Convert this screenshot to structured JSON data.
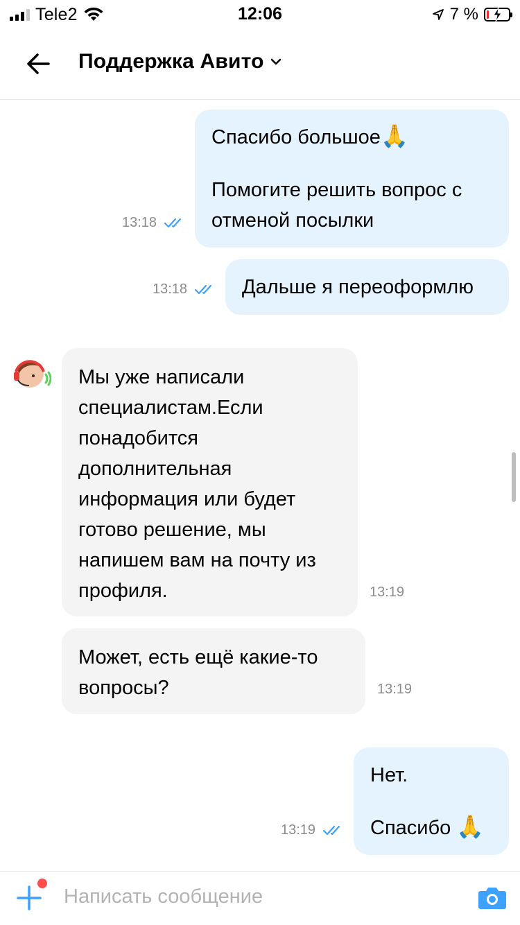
{
  "status_bar": {
    "carrier": "Tele2",
    "time": "12:06",
    "battery_percent": "7 %"
  },
  "header": {
    "title": "Поддержка Авито"
  },
  "messages": [
    {
      "direction": "out",
      "line1": "Спасибо большое",
      "emoji1": "🙏",
      "line2": "Помогите решить вопрос с",
      "line3": "отменой посылки",
      "time": "13:18"
    },
    {
      "direction": "out",
      "text": "Дальше я переоформлю",
      "time": "13:18"
    },
    {
      "direction": "in",
      "text": "Мы уже написали\nспециалистам.Если\nпонадобится\nдополнительная\nинформация или будет\nготово решение, мы\nнапишем вам на почту из\nпрофиля.",
      "time": "13:19"
    },
    {
      "direction": "in",
      "text": "Может, есть ещё какие-то\nвопросы?",
      "time": "13:19"
    },
    {
      "direction": "out",
      "line1": "Нет.",
      "line2": "Спасибо ",
      "emoji2": "🙏",
      "time": "13:19"
    }
  ],
  "composer": {
    "placeholder": "Написать сообщение"
  },
  "colors": {
    "outgoing_bubble": "#e5f3ff",
    "incoming_bubble": "#f4f4f4",
    "accent": "#3fa1ff",
    "notification_dot": "#ff4d4d"
  }
}
